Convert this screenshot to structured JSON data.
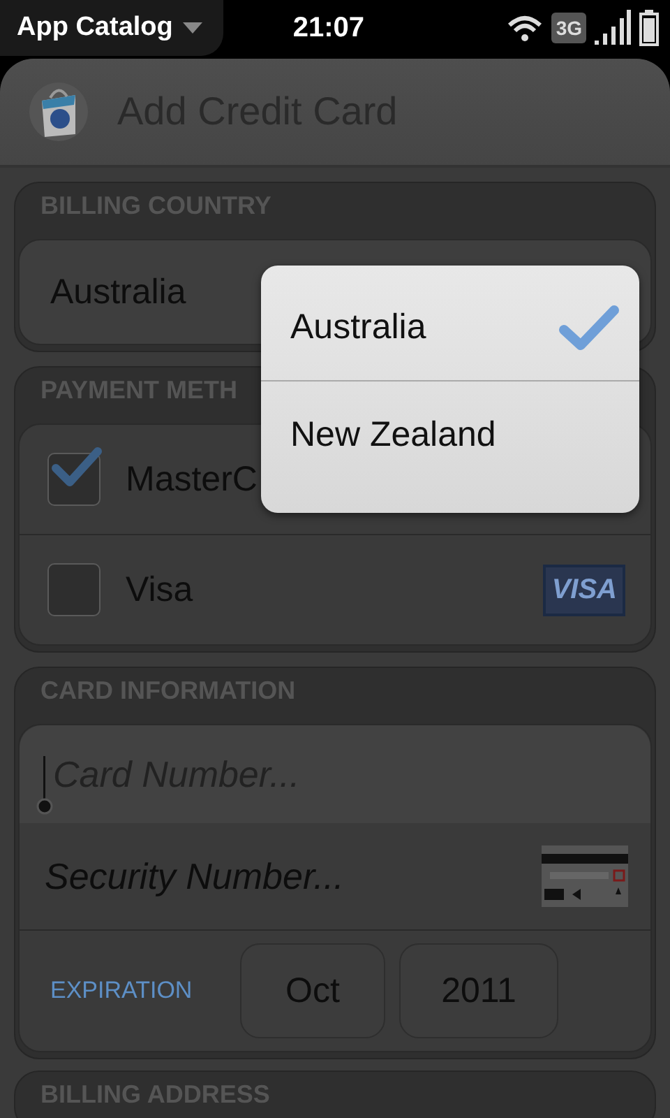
{
  "status_bar": {
    "app_menu": "App Catalog",
    "time": "21:07",
    "network": "3G"
  },
  "header": {
    "title": "Add Credit Card"
  },
  "billing_country": {
    "label": "BILLING COUNTRY",
    "value": "Australia"
  },
  "payment_method": {
    "label": "PAYMENT METH",
    "options": [
      {
        "name": "MasterC",
        "checked": true
      },
      {
        "name": "Visa",
        "checked": false,
        "logo": "VISA"
      }
    ]
  },
  "card_information": {
    "label": "CARD INFORMATION",
    "card_number": {
      "placeholder": "Card Number..."
    },
    "security_number": {
      "placeholder": "Security Number..."
    },
    "expiration": {
      "label": "EXPIRATION",
      "month": "Oct",
      "year": "2011"
    }
  },
  "billing_address": {
    "label": "BILLING ADDRESS"
  },
  "country_menu": {
    "items": [
      {
        "label": "Australia",
        "selected": true
      },
      {
        "label": "New Zealand",
        "selected": false
      }
    ]
  }
}
